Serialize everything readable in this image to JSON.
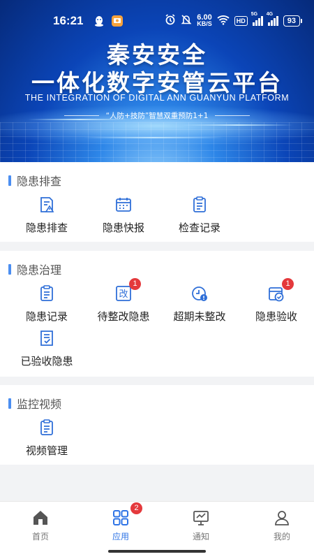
{
  "status_bar": {
    "time": "16:21",
    "speed_value": "6.00",
    "speed_unit": "KB/S",
    "hd_label": "HD",
    "signal1_label": "5G",
    "signal2_label": "4G",
    "battery": "93",
    "icons": [
      "qq-icon",
      "app-notification-icon",
      "alarm-icon",
      "mute-icon",
      "wifi-icon",
      "hd-icon",
      "signal-icon",
      "battery-icon"
    ]
  },
  "banner": {
    "title_line1": "秦安安全",
    "title_line2": "一体化数字安管云平台",
    "subtitle": "THE INTEGRATION OF DIGITAL ANN GUANYUN PLATFORM",
    "slogan": "“人防+技防”智慧双重预防1+1"
  },
  "sections": {
    "hazard_check": {
      "title": "隐患排查",
      "items": [
        {
          "label": "隐患排查",
          "icon": "hazard-inspection-icon"
        },
        {
          "label": "隐患快报",
          "icon": "calendar-report-icon"
        },
        {
          "label": "检查记录",
          "icon": "clipboard-record-icon"
        }
      ]
    },
    "hazard_govern": {
      "title": "隐患治理",
      "items": [
        {
          "label": "隐患记录",
          "icon": "clipboard-list-icon"
        },
        {
          "label": "待整改隐患",
          "icon": "rectify-icon",
          "badge": "1",
          "icon_text": "改"
        },
        {
          "label": "超期未整改",
          "icon": "overdue-clock-icon"
        },
        {
          "label": "隐患验收",
          "icon": "acceptance-check-icon",
          "badge": "1"
        },
        {
          "label": "已验收隐患",
          "icon": "accepted-document-icon"
        }
      ]
    },
    "video": {
      "title": "监控视频",
      "items": [
        {
          "label": "视频管理",
          "icon": "clipboard-video-icon"
        }
      ]
    }
  },
  "bottom_nav": {
    "items": [
      {
        "label": "首页",
        "icon": "home-icon",
        "active": false
      },
      {
        "label": "应用",
        "icon": "apps-grid-icon",
        "active": true,
        "badge": "2"
      },
      {
        "label": "通知",
        "icon": "monitor-notice-icon",
        "active": false
      },
      {
        "label": "我的",
        "icon": "profile-icon",
        "active": false
      }
    ]
  },
  "colors": {
    "accent": "#2f74e6",
    "section_bar": "#4b8ef1",
    "badge": "#e4393c",
    "icon_stroke": "#2f6fd8"
  }
}
